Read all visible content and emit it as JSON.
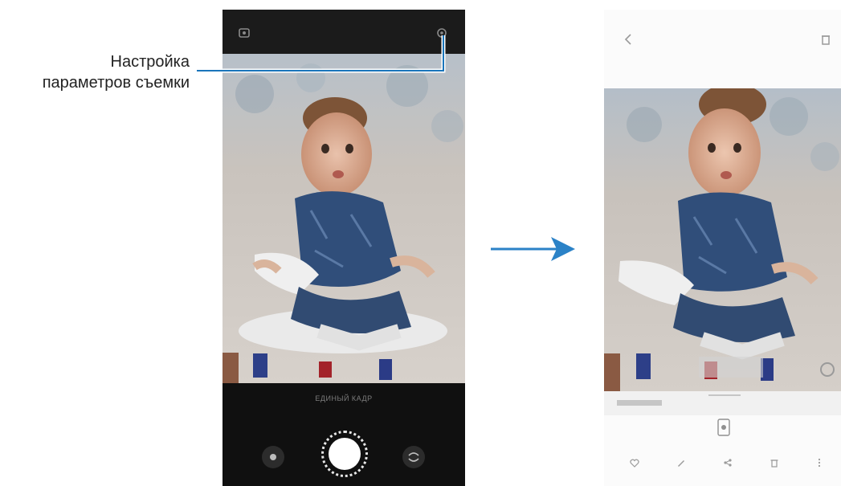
{
  "callout": {
    "line1": "Настройка",
    "line2": "параметров съемки"
  },
  "camera_screen": {
    "settings_icon": "settings-icon",
    "flash_icon": "flash-icon",
    "mode_label": "ЕДИНЫЙ КАДР"
  },
  "gallery_screen": {
    "back_icon": "back-icon",
    "delete_icon": "delete-icon",
    "toolbar_icons": [
      "like-icon",
      "edit-icon",
      "share-icon",
      "delete-icon",
      "more-icon"
    ]
  },
  "colors": {
    "callout_line": "#1a75bb",
    "arrow": "#2b82c7",
    "camera_bg": "#141414",
    "gallery_bg": "#fbfbfb"
  }
}
